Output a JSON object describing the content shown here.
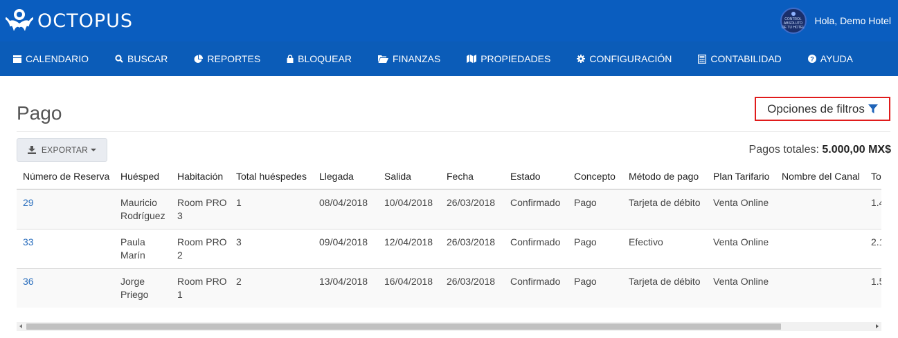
{
  "brand": {
    "name": "OCTOPUS",
    "header_color": "#0a5dbf",
    "nav_color": "#0b5cb8"
  },
  "user": {
    "greeting": "Hola, Demo Hotel",
    "avatar_text": "CONTROL ABSOLUTO DE TU HOTEL"
  },
  "nav": [
    {
      "label": "CALENDARIO",
      "icon": "calendar-icon"
    },
    {
      "label": "BUSCAR",
      "icon": "search-icon"
    },
    {
      "label": "REPORTES",
      "icon": "pie-chart-icon"
    },
    {
      "label": "BLOQUEAR",
      "icon": "lock-icon"
    },
    {
      "label": "FINANZAS",
      "icon": "folder-open-icon"
    },
    {
      "label": "PROPIEDADES",
      "icon": "map-icon"
    },
    {
      "label": "CONFIGURACIÓN",
      "icon": "gear-icon"
    },
    {
      "label": "CONTABILIDAD",
      "icon": "calculator-icon"
    },
    {
      "label": "AYUDA",
      "icon": "question-circle-icon"
    }
  ],
  "page": {
    "title": "Pago",
    "filters_label": "Opciones de filtros",
    "export_label": "EXPORTAR",
    "totals_label": "Pagos totales:",
    "totals_value": "5.000,00 MX$"
  },
  "table": {
    "columns": [
      "Número de Reserva",
      "Huésped",
      "Habitación",
      "Total huéspedes",
      "Llegada",
      "Salida",
      "Fecha",
      "Estado",
      "Concepto",
      "Método de pago",
      "Plan Tarifario",
      "Nombre del Canal",
      "To"
    ],
    "rows": [
      {
        "reserva": "29",
        "huesped": "Mauricio Rodríguez",
        "habitacion": "Room PRO 3",
        "total": "1",
        "llegada": "08/04/2018",
        "salida": "10/04/2018",
        "fecha": "26/03/2018",
        "estado": "Confirmado",
        "concepto": "Pago",
        "metodo": "Tarjeta de débito",
        "plan": "Venta Online",
        "canal": "",
        "to": "1.4"
      },
      {
        "reserva": "33",
        "huesped": "Paula Marín",
        "habitacion": "Room PRO 2",
        "total": "3",
        "llegada": "09/04/2018",
        "salida": "12/04/2018",
        "fecha": "26/03/2018",
        "estado": "Confirmado",
        "concepto": "Pago",
        "metodo": "Efectivo",
        "plan": "Venta Online",
        "canal": "",
        "to": "2.1"
      },
      {
        "reserva": "36",
        "huesped": "Jorge Priego",
        "habitacion": "Room PRO 1",
        "total": "2",
        "llegada": "13/04/2018",
        "salida": "16/04/2018",
        "fecha": "26/03/2018",
        "estado": "Confirmado",
        "concepto": "Pago",
        "metodo": "Tarjeta de débito",
        "plan": "Venta Online",
        "canal": "",
        "to": "1.5"
      }
    ]
  }
}
